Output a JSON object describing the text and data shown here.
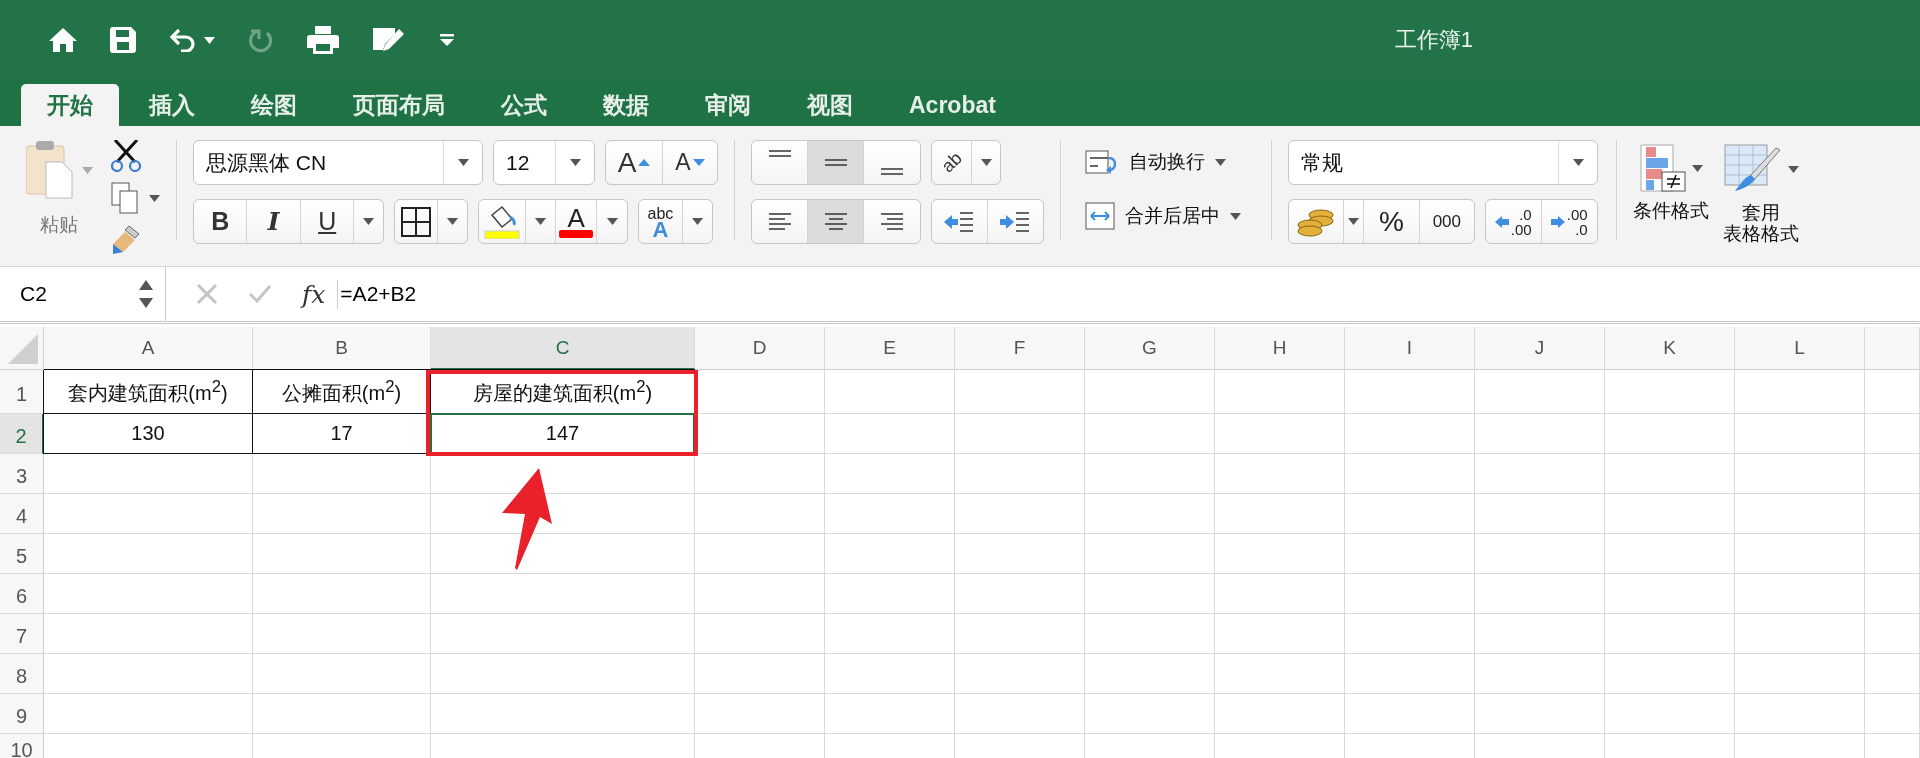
{
  "window": {
    "title": "工作簿1"
  },
  "quick_access": [
    {
      "kind": "home",
      "disabled": false
    },
    {
      "kind": "save",
      "disabled": false
    },
    {
      "kind": "undo",
      "disabled": false
    },
    {
      "kind": "redo",
      "disabled": true
    },
    {
      "kind": "print",
      "disabled": false
    },
    {
      "kind": "edit",
      "disabled": false
    },
    {
      "kind": "customize",
      "disabled": false
    }
  ],
  "tabs": [
    {
      "label": "开始",
      "selected": true
    },
    {
      "label": "插入",
      "selected": false
    },
    {
      "label": "绘图",
      "selected": false
    },
    {
      "label": "页面布局",
      "selected": false
    },
    {
      "label": "公式",
      "selected": false
    },
    {
      "label": "数据",
      "selected": false
    },
    {
      "label": "审阅",
      "selected": false
    },
    {
      "label": "视图",
      "selected": false
    },
    {
      "label": "Acrobat",
      "selected": false
    }
  ],
  "ribbon": {
    "paste_label": "粘贴",
    "font_name": "思源黑体 CN",
    "font_size": "12",
    "grow_font": "A",
    "shrink_font": "A",
    "bold": "B",
    "italic": "I",
    "underline": "U",
    "font_color": "A",
    "orientation": "ab",
    "phonetic_top": "abc",
    "phonetic_bottom": "A",
    "alignment": [
      {
        "kind": "top",
        "selected": false
      },
      {
        "kind": "middle",
        "selected": true
      },
      {
        "kind": "bottom",
        "selected": false
      },
      {
        "kind": "left",
        "selected": false
      },
      {
        "kind": "center",
        "selected": true
      },
      {
        "kind": "right",
        "selected": false
      }
    ],
    "wrap_text": "自动换行",
    "merge_center": "合并后居中",
    "number_format": "常规",
    "percent": "%",
    "comma": "000",
    "increase_decimal": [
      ".0",
      ".00"
    ],
    "decrease_decimal": [
      ".00",
      ".0"
    ],
    "conditional_formatting": "条件格式",
    "format_as_table": [
      "套用",
      "表格格式"
    ]
  },
  "formula_bar": {
    "name_box": "C2",
    "fx": "fx",
    "formula": "=A2+B2"
  },
  "sheet": {
    "columns": [
      {
        "label": "A",
        "selected": false
      },
      {
        "label": "B",
        "selected": false
      },
      {
        "label": "C",
        "selected": true
      },
      {
        "label": "D",
        "selected": false
      },
      {
        "label": "E",
        "selected": false
      },
      {
        "label": "F",
        "selected": false
      },
      {
        "label": "G",
        "selected": false
      },
      {
        "label": "H",
        "selected": false
      },
      {
        "label": "I",
        "selected": false
      },
      {
        "label": "J",
        "selected": false
      },
      {
        "label": "K",
        "selected": false
      },
      {
        "label": "L",
        "selected": false
      }
    ],
    "rows": [
      {
        "label": "1",
        "selected": false,
        "cells": [
          {
            "text": "套内建筑面积(m$^{2}$)",
            "selected": false
          },
          {
            "text": "公摊面积(m$^{2}$)",
            "selected": false
          },
          {
            "text": "房屋的建筑面积(m$^{2}$)",
            "selected": false
          }
        ]
      },
      {
        "label": "2",
        "selected": true,
        "cells": [
          {
            "text": "130",
            "selected": false
          },
          {
            "text": "17",
            "selected": false
          },
          {
            "text": "147",
            "selected": true
          }
        ]
      },
      {
        "label": "3",
        "selected": false,
        "cells": []
      },
      {
        "label": "4",
        "selected": false,
        "cells": []
      },
      {
        "label": "5",
        "selected": false,
        "cells": []
      },
      {
        "label": "6",
        "selected": false,
        "cells": []
      },
      {
        "label": "7",
        "selected": false,
        "cells": []
      },
      {
        "label": "8",
        "selected": false,
        "cells": []
      },
      {
        "label": "9",
        "selected": false,
        "cells": []
      },
      {
        "label": "10",
        "selected": false,
        "cells": []
      }
    ]
  }
}
